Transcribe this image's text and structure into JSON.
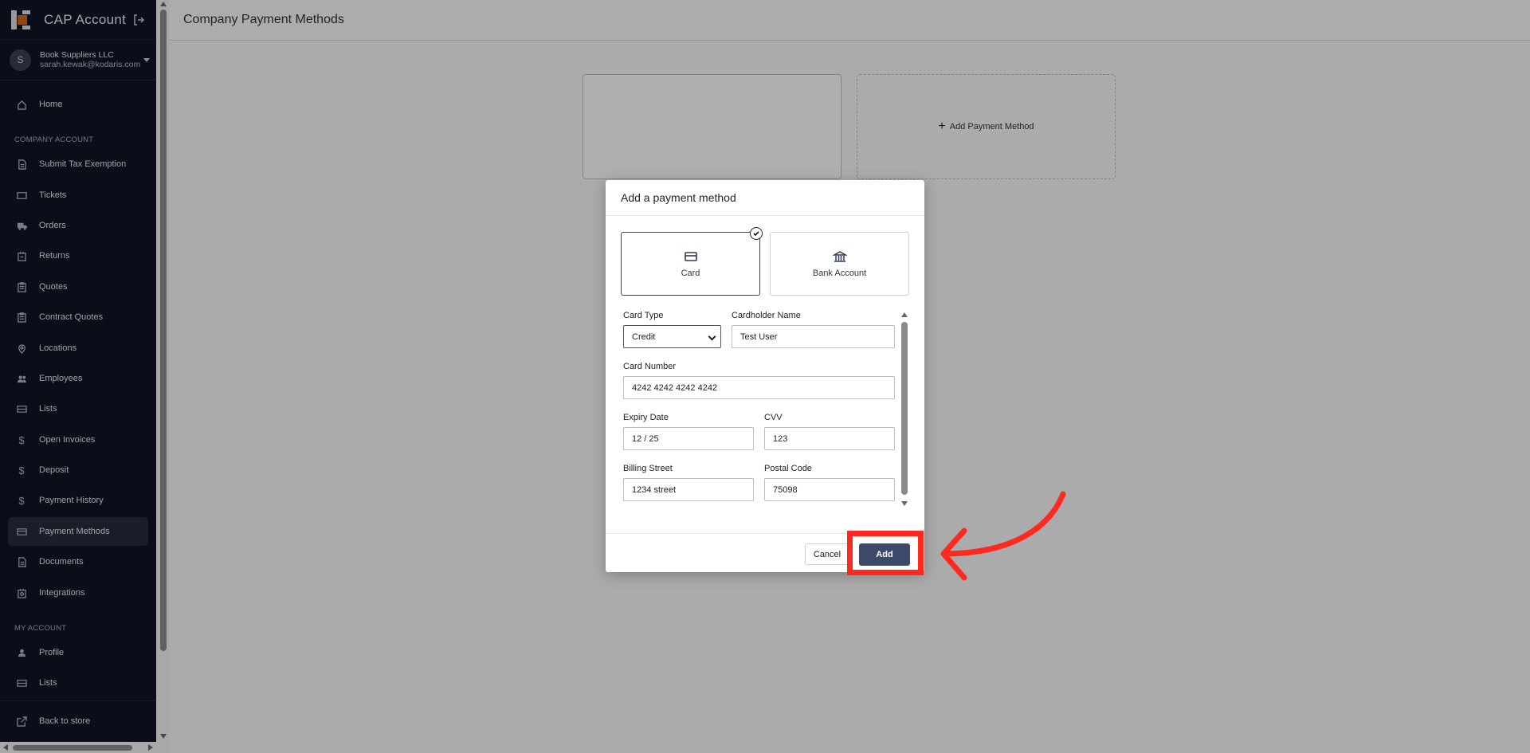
{
  "sidebar": {
    "app_title": "CAP Account",
    "user": {
      "initial": "S",
      "company": "Book Suppliers LLC",
      "email": "sarah.kewak@kodaris.com"
    },
    "home": "Home",
    "section_company": "COMPANY ACCOUNT",
    "company_items": [
      "Submit Tax Exemption",
      "Tickets",
      "Orders",
      "Returns",
      "Quotes",
      "Contract Quotes",
      "Locations",
      "Employees",
      "Lists",
      "Open Invoices",
      "Deposit",
      "Payment History",
      "Payment Methods",
      "Documents",
      "Integrations"
    ],
    "section_my": "MY ACCOUNT",
    "my_items": [
      "Profile",
      "Lists"
    ],
    "back": "Back to store"
  },
  "page": {
    "title": "Company Payment Methods",
    "add_payment_method": "Add Payment Method"
  },
  "modal": {
    "title": "Add a payment method",
    "types": {
      "card": "Card",
      "bank": "Bank Account"
    },
    "fields": {
      "card_type_label": "Card Type",
      "card_type_value": "Credit",
      "cardholder_label": "Cardholder Name",
      "cardholder_value": "Test User",
      "card_number_label": "Card Number",
      "card_number_value": "4242 4242 4242 4242",
      "expiry_label": "Expiry Date",
      "expiry_value": "12 / 25",
      "cvv_label": "CVV",
      "cvv_value": "123",
      "street_label": "Billing Street",
      "street_value": "1234 street",
      "postal_label": "Postal Code",
      "postal_value": "75098"
    },
    "cancel": "Cancel",
    "add": "Add"
  },
  "colors": {
    "sidebar_bg": "#0f1524",
    "primary_button": "#3c4968",
    "annotation": "#ff2a1f"
  }
}
